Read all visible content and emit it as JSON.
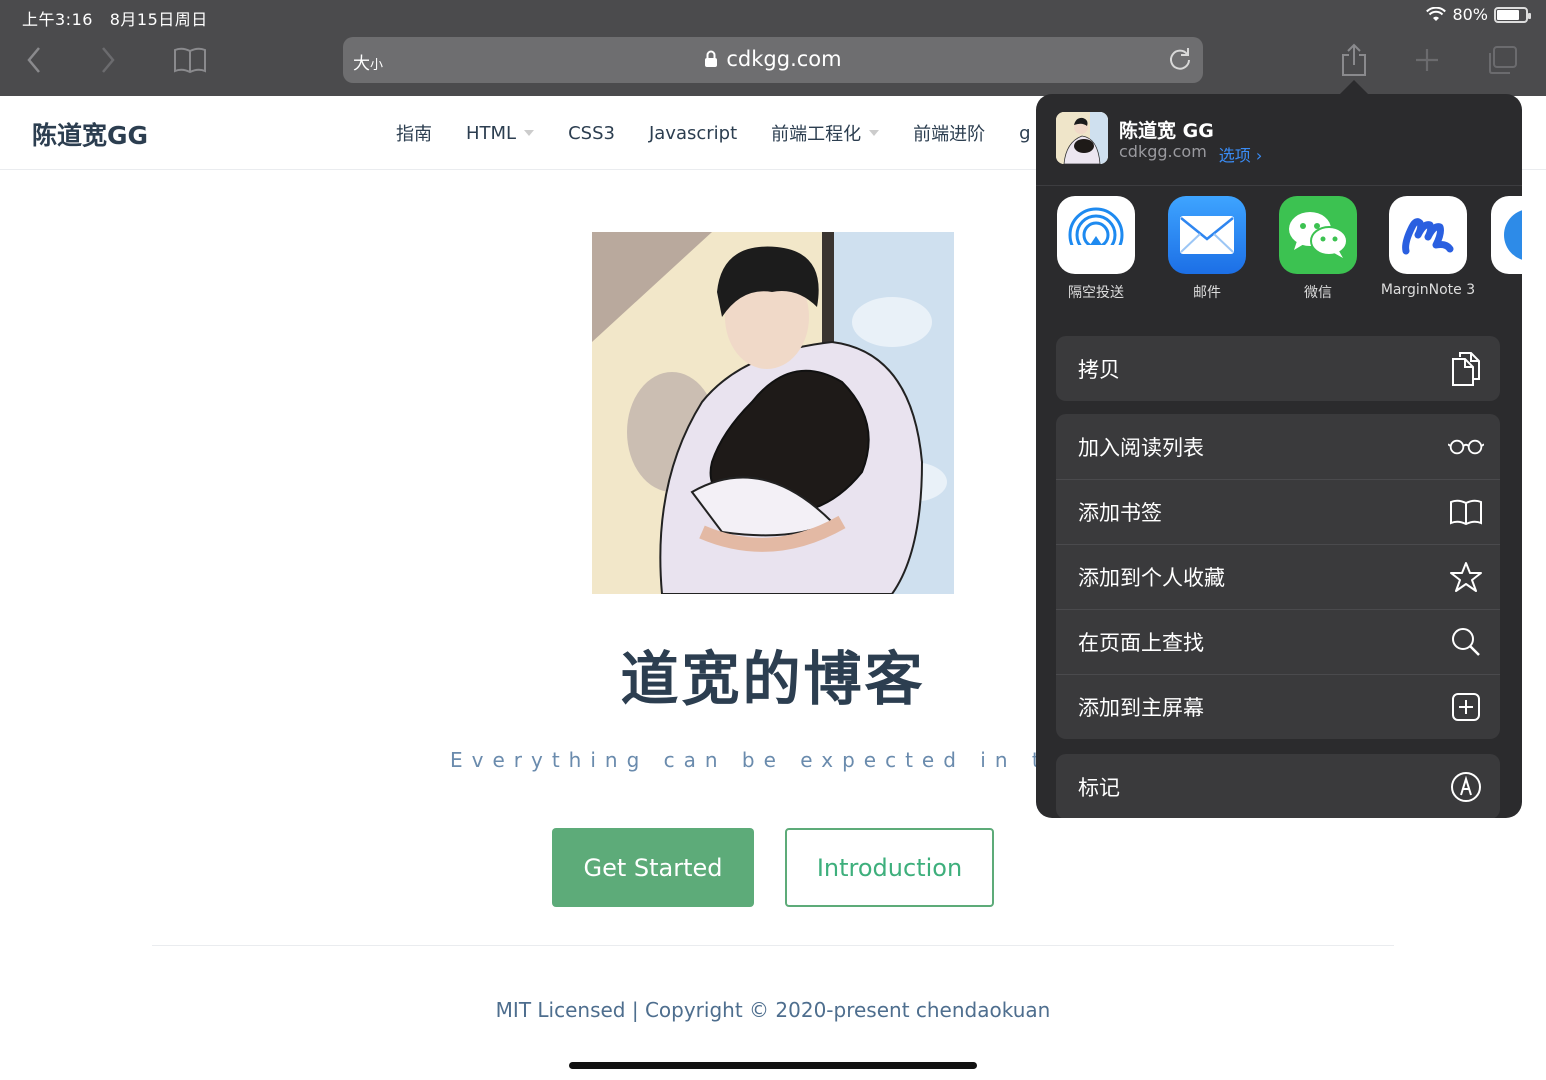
{
  "status": {
    "time": "上午3:16",
    "date": "8月15日周日",
    "battery_text": "80%",
    "battery_level": 0.8
  },
  "browser": {
    "aa_label": "大",
    "aa_small": "小",
    "url": "cdkgg.com"
  },
  "site": {
    "title": "陈道宽GG",
    "nav": [
      {
        "label": "指南",
        "dropdown": false
      },
      {
        "label": "HTML",
        "dropdown": true
      },
      {
        "label": "CSS3",
        "dropdown": false
      },
      {
        "label": "Javascript",
        "dropdown": false
      },
      {
        "label": "前端工程化",
        "dropdown": true
      },
      {
        "label": "前端进阶",
        "dropdown": false
      },
      {
        "label": "g",
        "dropdown": false
      }
    ],
    "hero_title": "道宽的博客",
    "tagline": "Everything can be expected in the fut",
    "primary_button": "Get Started",
    "secondary_button": "Introduction",
    "footer": "MIT Licensed | Copyright © 2020-present chendaokuan"
  },
  "share_sheet": {
    "title": "陈道宽 GG",
    "domain": "cdkgg.com",
    "options_label": "选项 ›",
    "apps": [
      {
        "label": "隔空投送",
        "icon": "airdrop-icon",
        "color": "#ffffff"
      },
      {
        "label": "邮件",
        "icon": "mail-icon",
        "color": "#2f86f0"
      },
      {
        "label": "微信",
        "icon": "wechat-icon",
        "color": "#3cc251"
      },
      {
        "label": "MarginNote 3",
        "icon": "marginnote-icon",
        "color": "#ffffff"
      }
    ],
    "actions_group1": [
      {
        "label": "拷贝",
        "icon": "copy-icon"
      }
    ],
    "actions_group2": [
      {
        "label": "加入阅读列表",
        "icon": "glasses-icon"
      },
      {
        "label": "添加书签",
        "icon": "book-icon"
      },
      {
        "label": "添加到个人收藏",
        "icon": "star-icon"
      },
      {
        "label": "在页面上查找",
        "icon": "search-icon"
      },
      {
        "label": "添加到主屏幕",
        "icon": "add-square-icon"
      }
    ],
    "actions_group3": [
      {
        "label": "标记",
        "icon": "markup-icon"
      }
    ]
  },
  "colors": {
    "accent_green": "#5dab79",
    "link_blue": "#3a8cf5",
    "chrome_gray": "#4b4b4d",
    "sheet_bg": "#2b2b2d"
  }
}
